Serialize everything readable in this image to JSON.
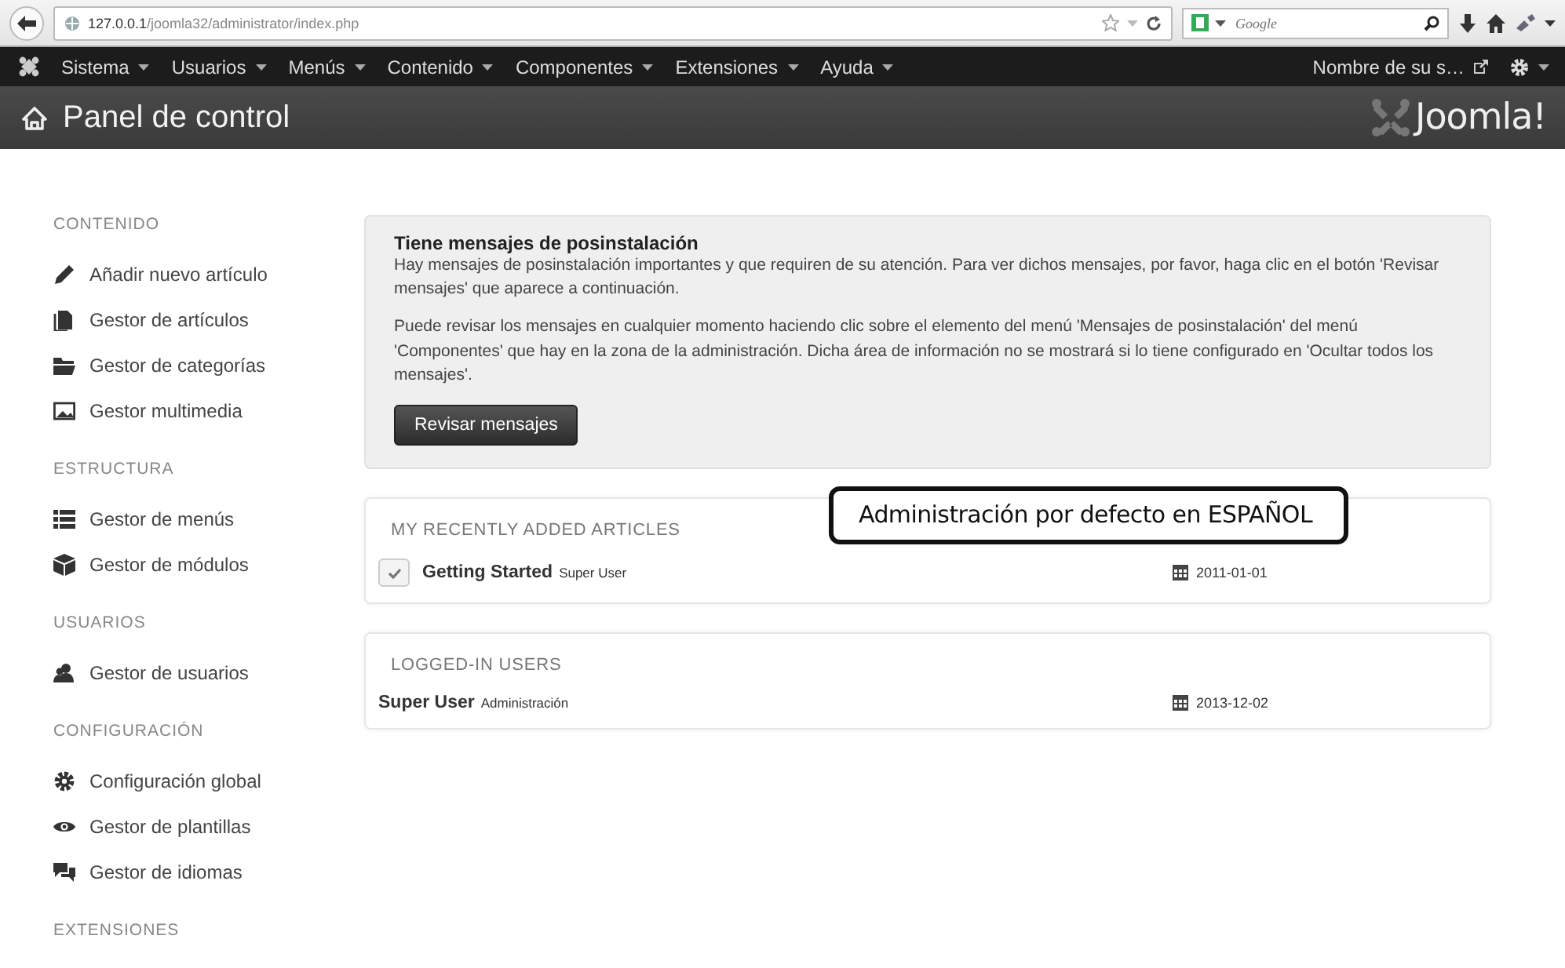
{
  "browser": {
    "url": "127.0.0.1/joomla32/administrator/index.php",
    "search_placeholder": "Google"
  },
  "navbar": {
    "menus": [
      "Sistema",
      "Usuarios",
      "Menús",
      "Contenido",
      "Componentes",
      "Extensiones",
      "Ayuda"
    ],
    "site_link": "Nombre de su s…"
  },
  "header": {
    "title": "Panel de control",
    "logo": "Joomla!"
  },
  "sidebar": {
    "sections": [
      {
        "title": "CONTENIDO",
        "items": [
          {
            "label": "Añadir nuevo artículo",
            "kind": "add"
          },
          {
            "label": "Gestor de artículos",
            "kind": "articles"
          },
          {
            "label": "Gestor de categorías",
            "kind": "categories"
          },
          {
            "label": "Gestor multimedia",
            "kind": "media"
          }
        ]
      },
      {
        "title": "ESTRUCTURA",
        "items": [
          {
            "label": "Gestor de menús",
            "kind": "menus"
          },
          {
            "label": "Gestor de módulos",
            "kind": "modules"
          }
        ]
      },
      {
        "title": "USUARIOS",
        "items": [
          {
            "label": "Gestor de usuarios",
            "kind": "users"
          }
        ]
      },
      {
        "title": "CONFIGURACIÓN",
        "items": [
          {
            "label": "Configuración global",
            "kind": "config"
          },
          {
            "label": "Gestor de plantillas",
            "kind": "templates"
          },
          {
            "label": "Gestor de idiomas",
            "kind": "languages"
          }
        ]
      },
      {
        "title": "EXTENSIONES"
      }
    ]
  },
  "message": {
    "title": "Tiene mensajes de posinstalación",
    "paragraphs": [
      "Hay mensajes de posinstalación importantes y que requiren de su atención. Para ver dichos mensajes, por favor, haga clic en el botón 'Revisar mensajes' que aparece a continuación.",
      "Puede revisar los mensajes en cualquier momento haciendo clic sobre el elemento del menú 'Mensajes de posinstalación' del menú 'Componentes' que hay en la zona de la administración. Dicha área de información no se mostrará si lo tiene configurado en 'Ocultar todos los mensajes'."
    ],
    "button": "Revisar mensajes"
  },
  "callout": "Administración por defecto en ESPAÑOL",
  "modules": [
    {
      "title": "MY RECENTLY ADDED ARTICLES",
      "rows": [
        {
          "kind": "article",
          "name": "Getting Started",
          "detail": "Super User",
          "date": "2011-01-01",
          "published": true
        }
      ]
    },
    {
      "title": "LOGGED-IN USERS",
      "rows": [
        {
          "kind": "user",
          "name": "Super User",
          "detail": "Administración",
          "date": "2013-12-02"
        }
      ]
    }
  ]
}
